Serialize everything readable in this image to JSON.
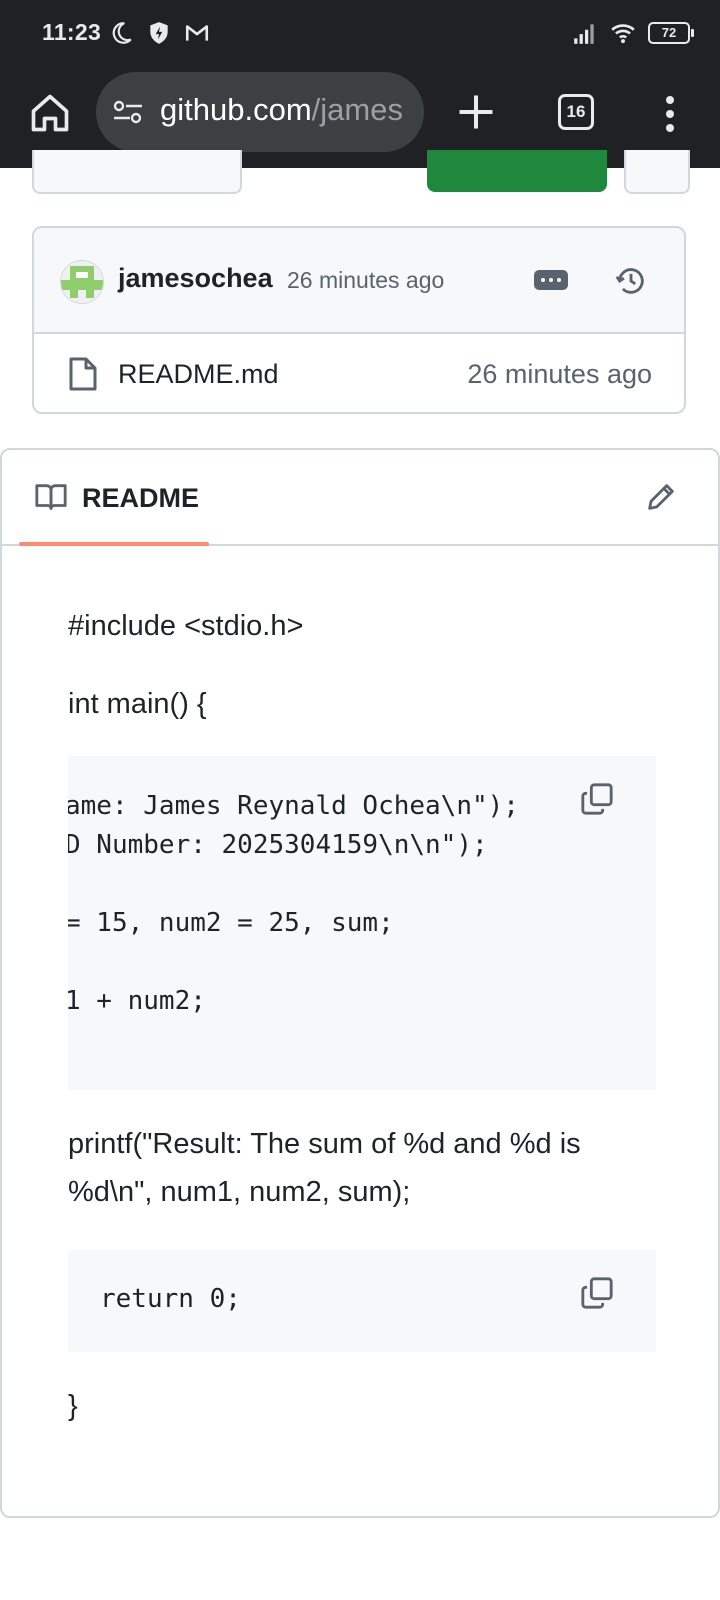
{
  "status_bar": {
    "time": "11:23",
    "battery": "72"
  },
  "browser": {
    "url_host": "github.com",
    "url_path": "/james",
    "tab_count": "16"
  },
  "commit": {
    "author": "jamesochea",
    "time": "26 minutes ago"
  },
  "files": [
    {
      "name": "README.md",
      "time": "26 minutes ago"
    }
  ],
  "readme": {
    "tab_label": "README",
    "paragraphs": {
      "include": "#include <stdio.h>",
      "main": "int main() {",
      "printf_line1": "printf(\"Result: The sum of %d and %d is",
      "printf_line2": "%d\\n\", num1, num2, sum);",
      "close": "}"
    },
    "code_block_1": [
      "ame: James Reynald Ochea\\n\");",
      "D Number: 2025304159\\n\\n\");",
      "",
      "= 15, num2 = 25, sum;",
      "",
      "1 + num2;"
    ],
    "code_block_2": [
      "return 0;"
    ]
  },
  "colors": {
    "chrome_bg": "#202124",
    "url_bg": "#3c4043",
    "github_green": "#1f883d",
    "tab_underline": "#fd8c73",
    "border": "#d0d7de",
    "code_bg": "#f6f8fa"
  }
}
